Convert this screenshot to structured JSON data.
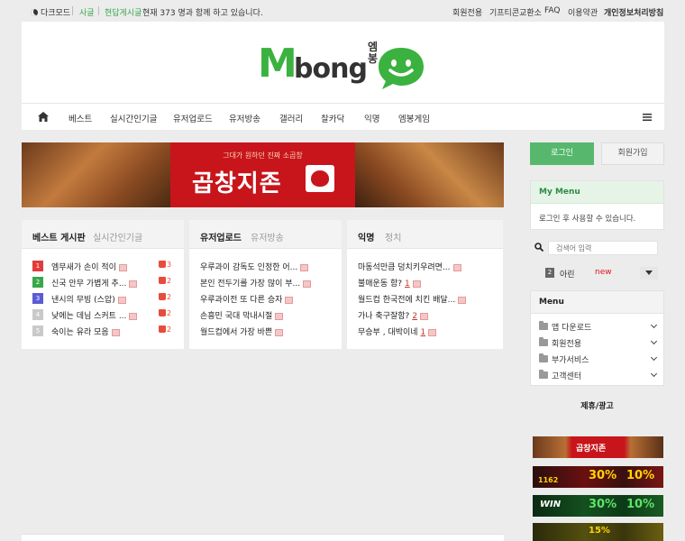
{
  "topbar": {
    "darkmode": "다크모드",
    "tab_all": "사글",
    "tab_realtime": "현답게시글",
    "online_text": "현재 373 명과 함께 하고 있습니다.",
    "links": [
      "회원전용",
      "기프티콘교환소",
      "FAQ",
      "이용약관",
      "개인정보처리방침"
    ]
  },
  "logo": {
    "m": "M",
    "bong": "bong",
    "korean": "엠봉"
  },
  "nav": {
    "items": [
      "베스트",
      "실시간인기글",
      "유저업로드",
      "유저방송",
      "갤러리",
      "찰카닥",
      "익명",
      "엠봉게임"
    ]
  },
  "banner": {
    "tagline": "그대가 원하던 진짜 소곱창",
    "brand": "곱창지존"
  },
  "boards": {
    "best": {
      "tab_active": "베스트 게시판",
      "tab_inactive": "실시간인기글",
      "rows": [
        {
          "rank": "1",
          "title": "엠무새가 손이 적이",
          "likes": "3",
          "color": "#e23b3b"
        },
        {
          "rank": "2",
          "title": "신국 안무 가볍게 추...",
          "likes": "2",
          "color": "#3aa64b"
        },
        {
          "rank": "3",
          "title": "낸시의 무빙 (스압)",
          "likes": "2",
          "color": "#5b5bd6"
        },
        {
          "rank": "4",
          "title": "낮에는 데님 스커트 ...",
          "likes": "2",
          "color": "#c9c9c9"
        },
        {
          "rank": "5",
          "title": "숙이는 유라 모음",
          "likes": "2",
          "color": "#c9c9c9"
        }
      ]
    },
    "upload": {
      "tab_active": "유저업로드",
      "tab_inactive": "유저방송",
      "rows": [
        {
          "title": "우루과이 감독도 인정한 어..."
        },
        {
          "title": "본인 전두기를 가장 많이 부..."
        },
        {
          "title": "우루과이전 또 다른 승자"
        },
        {
          "title": "손흥민 국대 막내시절"
        },
        {
          "title": "월드컵에서 가장 바쁜"
        }
      ]
    },
    "anon": {
      "tab_active": "익명",
      "tab_inactive": "정치",
      "rows": [
        {
          "title": "마동석만큼 덩치키우려면...",
          "comments": ""
        },
        {
          "title": "불매운동 함?",
          "comments": "1"
        },
        {
          "title": "월드컵 한국전에 치킨 배달...",
          "comments": ""
        },
        {
          "title": "가나 축구잘함?",
          "comments": "2"
        },
        {
          "title": "무승부 , 대박이네",
          "comments": "1"
        }
      ]
    }
  },
  "sidebar": {
    "login": "로그인",
    "join": "회원가입",
    "mymenu_title": "My Menu",
    "mymenu_text": "로그인 후 사용할 수 있습니다.",
    "search_placeholder": "검색어 입력",
    "rank_num": "2",
    "rank_text": "아린",
    "rank_badge": "new",
    "menu_title": "Menu",
    "menu_items": [
      "앱 다운로드",
      "회원전용",
      "부가서비스",
      "고객센터"
    ],
    "ad_title": "제휴/광고"
  },
  "ads": {
    "ad1_text": "곱창지존",
    "ad2_num": "1162",
    "ad2_pct": "30%",
    "ad2_pct2": "10%",
    "ad3_word": "WIN",
    "ad3_pct": "30%",
    "ad3_pct2": "10%",
    "ad4_pct": "15%"
  },
  "colors": {
    "brand_green": "#3bb23f",
    "login_green": "#57b86d",
    "banner_red": "#c8151b",
    "accent_red": "#e74c3c"
  }
}
